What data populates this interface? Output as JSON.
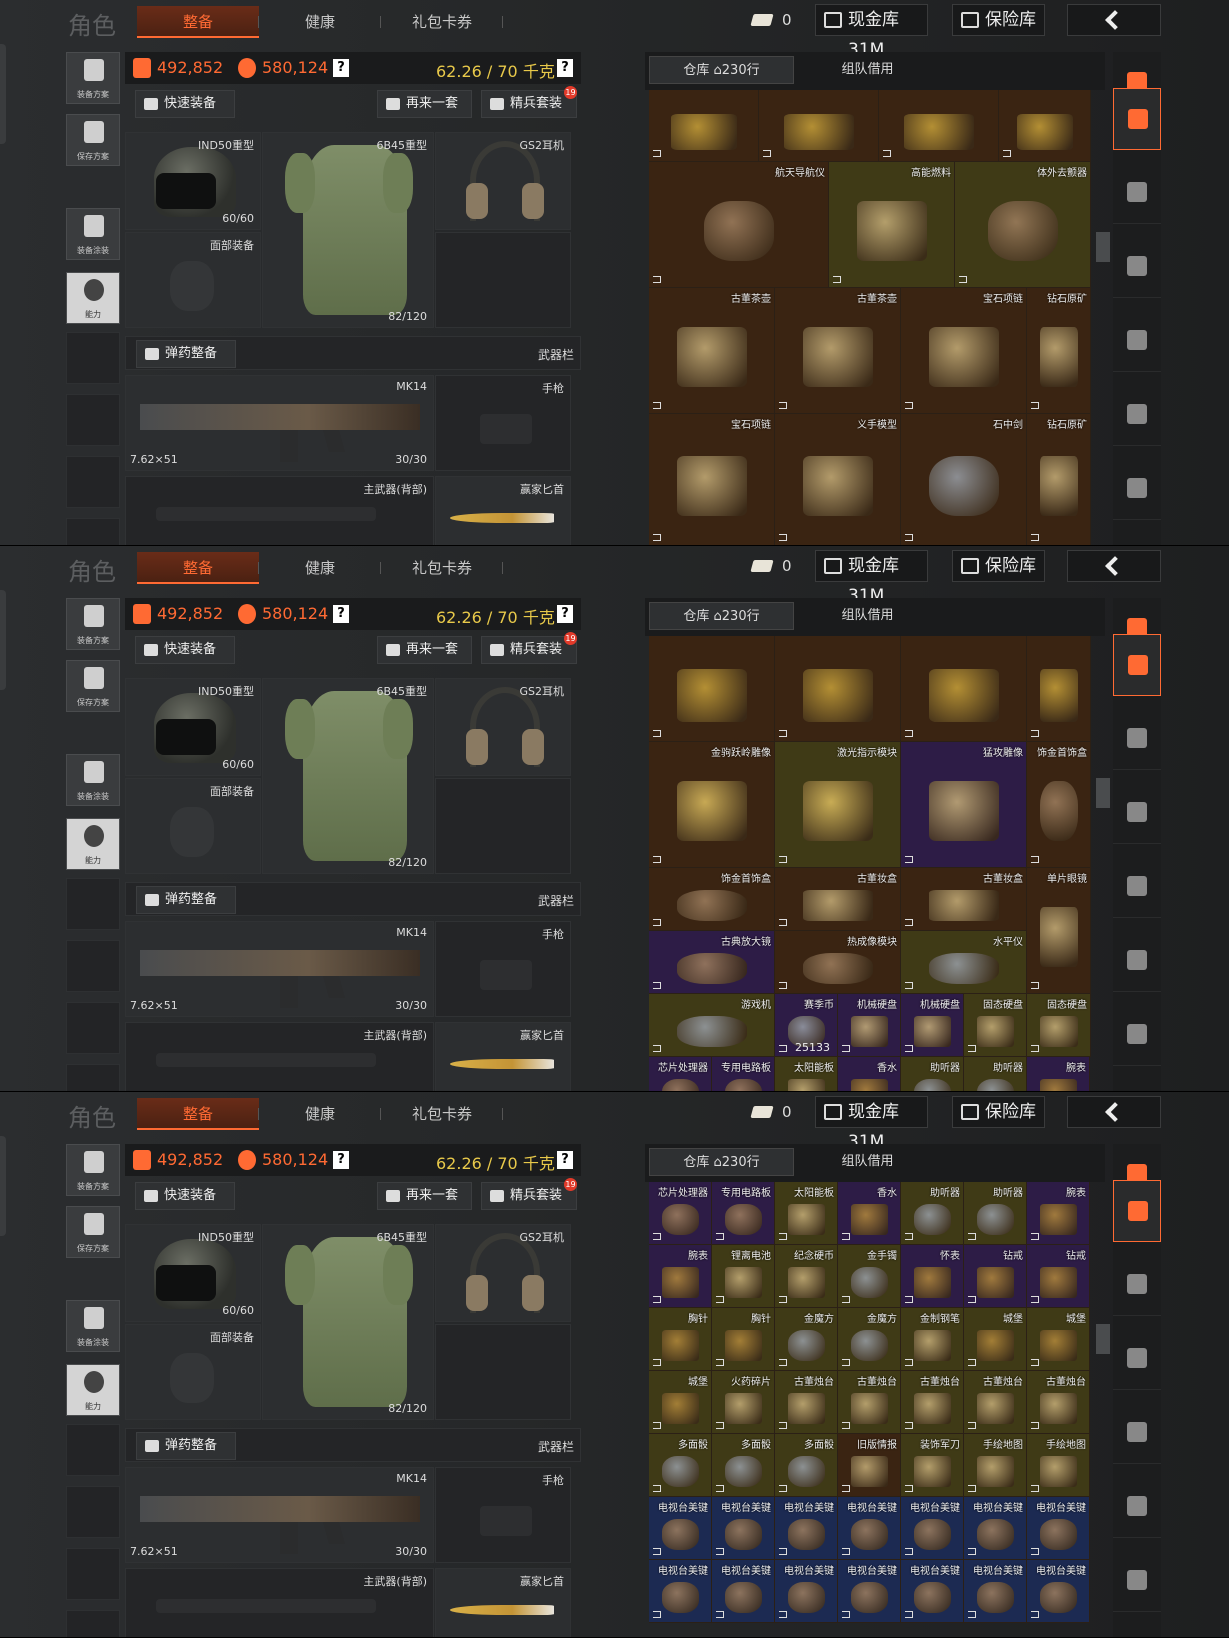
{
  "topbar": {
    "title": "角色",
    "tabs": [
      "整备",
      "健康",
      "礼包卡券"
    ],
    "tickets": "0",
    "cash_label": "现金库 31M",
    "vault_label": "保险库"
  },
  "sidebar": {
    "items": [
      "装备方案",
      "保存方案",
      "装备涂装",
      "能力"
    ]
  },
  "resources": {
    "orange_value": "492,852",
    "red_value": "580,124",
    "help": "?",
    "weight": "62.26 / 70 千克"
  },
  "buttons": {
    "quick_equip": "快速装备",
    "another_set": "再来一套",
    "elite_set": "精兵套装",
    "elite_badge": "19",
    "ammo": "弹药整备",
    "weapon_bar": "武器栏"
  },
  "slots": {
    "helmet": {
      "name": "IND50重型",
      "durability": "60/60"
    },
    "armor": {
      "name": "6B45重型",
      "durability": "82/120"
    },
    "headset": {
      "name": "GS2耳机"
    },
    "face": {
      "name": "面部装备"
    },
    "primary": {
      "name": "MK14",
      "ammo": "30/30",
      "caliber": "7.62×51"
    },
    "pistol": {
      "name": "手枪"
    },
    "back_weapon": {
      "name": "主武器(背部)"
    },
    "melee": {
      "name": "赢家匕首"
    }
  },
  "stash": {
    "tab_warehouse": "仓库",
    "rows": "230行",
    "tab_team": "组队借用"
  },
  "panels": [
    {
      "cells": [
        {
          "name": ""
        },
        {
          "name": ""
        },
        {
          "name": ""
        },
        {
          "name": ""
        },
        {
          "name": "航天导航仪"
        },
        {
          "name": "高能燃料"
        },
        {
          "name": "体外去颤器"
        },
        {
          "name": "古董茶壶"
        },
        {
          "name": "古董茶壶"
        },
        {
          "name": "宝石项链"
        },
        {
          "name": "钻石原矿"
        },
        {
          "name": "宝石项链"
        },
        {
          "name": "义手模型"
        },
        {
          "name": "石中剑"
        },
        {
          "name": "钻石原矿"
        }
      ]
    },
    {
      "cells": [
        {
          "name": ""
        },
        {
          "name": ""
        },
        {
          "name": ""
        },
        {
          "name": ""
        },
        {
          "name": "金驹跃岭雕像"
        },
        {
          "name": "激光指示模块"
        },
        {
          "name": "猛攻雕像"
        },
        {
          "name": "饰金首饰盒"
        },
        {
          "name": "饰金首饰盒"
        },
        {
          "name": "古董妆盒"
        },
        {
          "name": "古董妆盒"
        },
        {
          "name": "单片眼镜"
        },
        {
          "name": "古典放大镜"
        },
        {
          "name": "热成像模块"
        },
        {
          "name": "水平仪"
        },
        {
          "name": "游戏机"
        },
        {
          "name": "赛季币",
          "qty": "25133"
        },
        {
          "name": "机械硬盘"
        },
        {
          "name": "机械硬盘"
        },
        {
          "name": "固态硬盘"
        },
        {
          "name": "固态硬盘"
        },
        {
          "name": "芯片处理器"
        },
        {
          "name": "专用电路板"
        },
        {
          "name": "太阳能板"
        },
        {
          "name": "香水"
        },
        {
          "name": "助听器"
        },
        {
          "name": "助听器"
        },
        {
          "name": "腕表"
        }
      ]
    },
    {
      "cells": [
        {
          "name": "芯片处理器"
        },
        {
          "name": "专用电路板"
        },
        {
          "name": "太阳能板"
        },
        {
          "name": "香水"
        },
        {
          "name": "助听器"
        },
        {
          "name": "助听器"
        },
        {
          "name": "腕表"
        },
        {
          "name": "腕表"
        },
        {
          "name": "锂离电池"
        },
        {
          "name": "纪念硬币"
        },
        {
          "name": "金手镯"
        },
        {
          "name": "怀表"
        },
        {
          "name": "钻戒"
        },
        {
          "name": "钻戒"
        },
        {
          "name": "胸针"
        },
        {
          "name": "胸针"
        },
        {
          "name": "金魔方"
        },
        {
          "name": "金魔方"
        },
        {
          "name": "金制钢笔"
        },
        {
          "name": "城堡"
        },
        {
          "name": "城堡"
        },
        {
          "name": "城堡"
        },
        {
          "name": "火药碎片"
        },
        {
          "name": "古董烛台"
        },
        {
          "name": "古董烛台"
        },
        {
          "name": "古董烛台"
        },
        {
          "name": "古董烛台"
        },
        {
          "name": "古董烛台"
        },
        {
          "name": "多面骰"
        },
        {
          "name": "多面骰"
        },
        {
          "name": "多面骰"
        },
        {
          "name": "旧版情报"
        },
        {
          "name": "装饰军刀"
        },
        {
          "name": "手绘地图"
        },
        {
          "name": "手绘地图"
        },
        {
          "name": "电视台美键"
        },
        {
          "name": "电视台美键"
        },
        {
          "name": "电视台美键"
        },
        {
          "name": "电视台美键"
        },
        {
          "name": "电视台美键"
        },
        {
          "name": "电视台美键"
        },
        {
          "name": "电视台美键"
        },
        {
          "name": "电视台美键"
        },
        {
          "name": "电视台美键"
        },
        {
          "name": "电视台美键"
        },
        {
          "name": "电视台美键"
        },
        {
          "name": "电视台美键"
        },
        {
          "name": "电视台美键"
        },
        {
          "name": "电视台美键"
        }
      ]
    }
  ],
  "colors": {
    "accent": "#ff6a33",
    "weight": "#e8c94a"
  }
}
